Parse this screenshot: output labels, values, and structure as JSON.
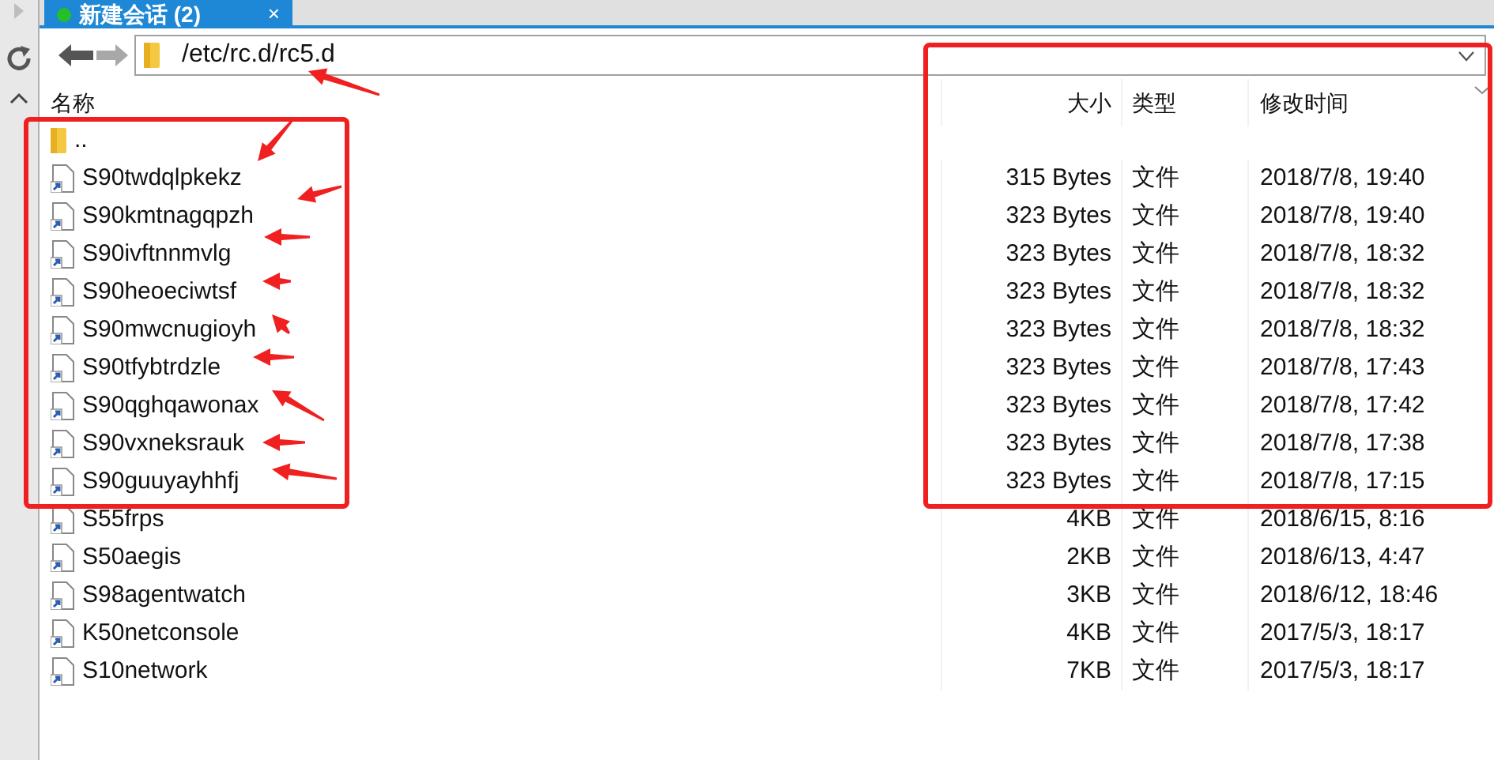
{
  "tab": {
    "title": "新建会话 (2)",
    "close": "×",
    "selected": true
  },
  "address": "/etc/rc.d/rc5.d",
  "columns": [
    "名称",
    "大小",
    "类型",
    "修改时间"
  ],
  "rows": [
    {
      "kind": "folder",
      "name": ".."
    },
    {
      "kind": "file",
      "name": "S90twdqlpkekz",
      "size": "315 Bytes",
      "type": "文件",
      "modified": "2018/7/8, 19:40"
    },
    {
      "kind": "file",
      "name": "S90kmtnagqpzh",
      "size": "323 Bytes",
      "type": "文件",
      "modified": "2018/7/8, 19:40"
    },
    {
      "kind": "file",
      "name": "S90ivftnnmvlg",
      "size": "323 Bytes",
      "type": "文件",
      "modified": "2018/7/8, 18:32"
    },
    {
      "kind": "file",
      "name": "S90heoeciwtsf",
      "size": "323 Bytes",
      "type": "文件",
      "modified": "2018/7/8, 18:32"
    },
    {
      "kind": "file",
      "name": "S90mwcnugioyh",
      "size": "323 Bytes",
      "type": "文件",
      "modified": "2018/7/8, 18:32"
    },
    {
      "kind": "file",
      "name": "S90tfybtrdzle",
      "size": "323 Bytes",
      "type": "文件",
      "modified": "2018/7/8, 17:43"
    },
    {
      "kind": "file",
      "name": "S90qghqawonax",
      "size": "323 Bytes",
      "type": "文件",
      "modified": "2018/7/8, 17:42"
    },
    {
      "kind": "file",
      "name": "S90vxneksrauk",
      "size": "323 Bytes",
      "type": "文件",
      "modified": "2018/7/8, 17:38"
    },
    {
      "kind": "file",
      "name": "S90guuyayhhfj",
      "size": "323 Bytes",
      "type": "文件",
      "modified": "2018/7/8, 17:15"
    },
    {
      "kind": "file",
      "name": "S55frps",
      "size": "4KB",
      "type": "文件",
      "modified": "2018/6/15, 8:16"
    },
    {
      "kind": "file",
      "name": "S50aegis",
      "size": "2KB",
      "type": "文件",
      "modified": "2018/6/13, 4:47"
    },
    {
      "kind": "file",
      "name": "S98agentwatch",
      "size": "3KB",
      "type": "文件",
      "modified": "2018/6/12, 18:46"
    },
    {
      "kind": "file",
      "name": "K50netconsole",
      "size": "4KB",
      "type": "文件",
      "modified": "2017/5/3, 18:17"
    },
    {
      "kind": "file",
      "name": "S10network",
      "size": "7KB",
      "type": "文件",
      "modified": "2017/5/3, 18:17"
    }
  ]
}
